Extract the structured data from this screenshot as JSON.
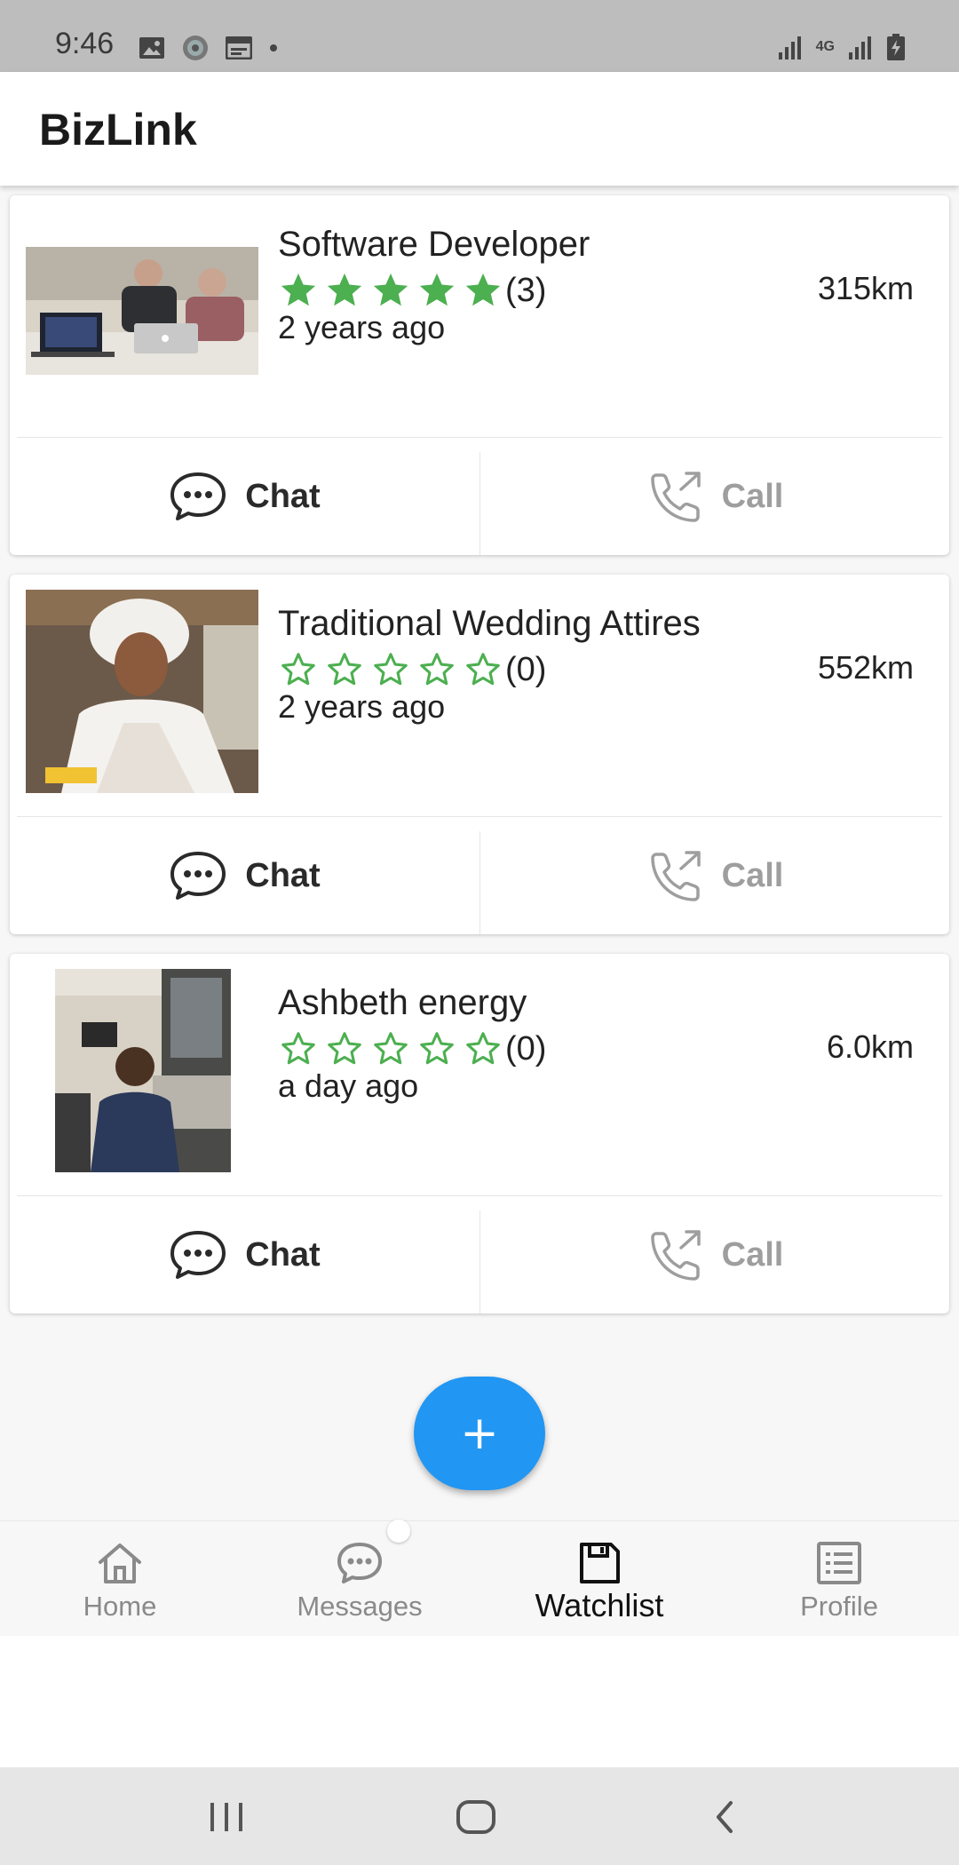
{
  "status_bar": {
    "time": "9:46",
    "network": "4G"
  },
  "app": {
    "title": "BizLink"
  },
  "listings": [
    {
      "title": "Software Developer",
      "rating": 5,
      "rating_count": "(3)",
      "time": "2 years ago",
      "distance": "315km",
      "chat_label": "Chat",
      "call_label": "Call"
    },
    {
      "title": "Traditional Wedding Attires",
      "rating": 0,
      "rating_count": "(0)",
      "time": "2 years ago",
      "distance": "552km",
      "chat_label": "Chat",
      "call_label": "Call"
    },
    {
      "title": "Ashbeth energy",
      "rating": 0,
      "rating_count": "(0)",
      "time": "a day ago",
      "distance": "6.0km",
      "chat_label": "Chat",
      "call_label": "Call"
    }
  ],
  "fab": {
    "icon": "plus-icon"
  },
  "bottom_nav": {
    "items": [
      {
        "label": "Home",
        "icon": "home-icon"
      },
      {
        "label": "Messages",
        "icon": "chat-icon"
      },
      {
        "label": "Watchlist",
        "icon": "save-icon",
        "active": true
      },
      {
        "label": "Profile",
        "icon": "list-icon"
      }
    ]
  },
  "colors": {
    "accent": "#2196f3",
    "star": "#4caf50",
    "muted": "#9e9e9e"
  }
}
